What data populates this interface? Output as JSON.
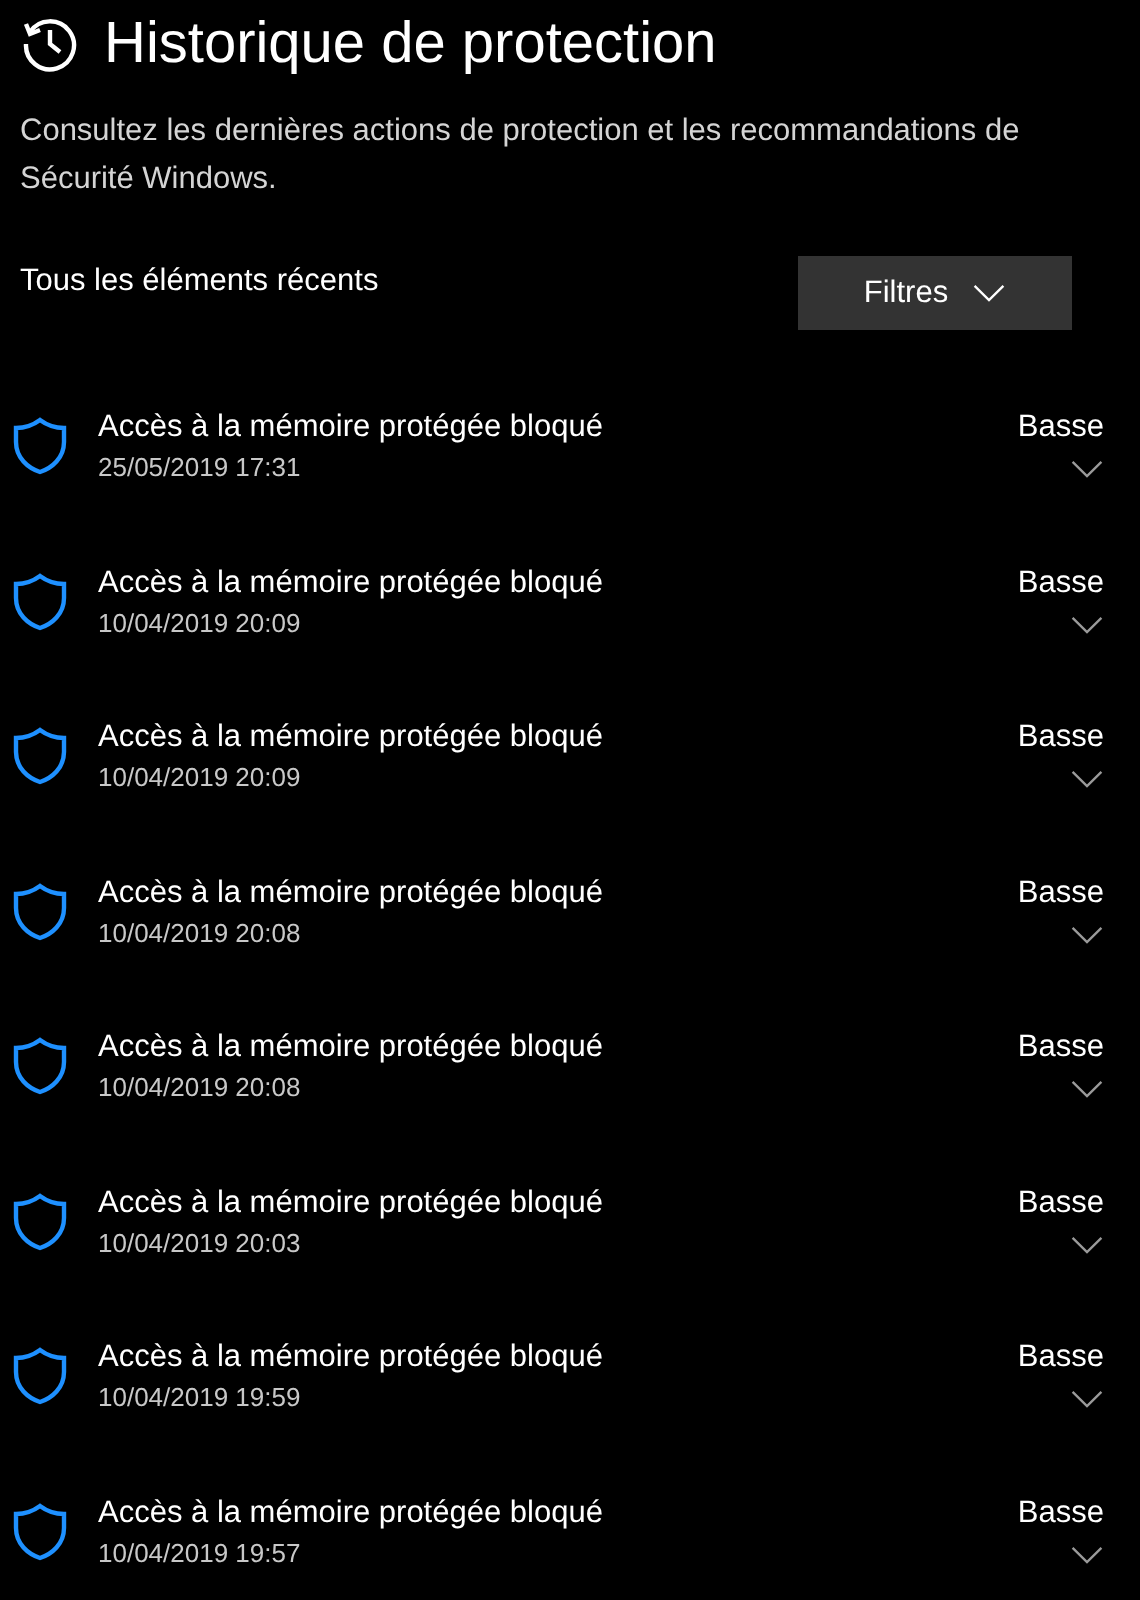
{
  "title": "Historique de protection",
  "description": "Consultez les dernières actions de protection et les recommandations de Sécurité Windows.",
  "list_heading": "Tous les éléments récents",
  "filter_button": {
    "label": "Filtres"
  },
  "items": [
    {
      "title": "Accès à la mémoire protégée bloqué",
      "date": "25/05/2019 17:31",
      "severity": "Basse"
    },
    {
      "title": "Accès à la mémoire protégée bloqué",
      "date": "10/04/2019 20:09",
      "severity": "Basse"
    },
    {
      "title": "Accès à la mémoire protégée bloqué",
      "date": "10/04/2019 20:09",
      "severity": "Basse"
    },
    {
      "title": "Accès à la mémoire protégée bloqué",
      "date": "10/04/2019 20:08",
      "severity": "Basse"
    },
    {
      "title": "Accès à la mémoire protégée bloqué",
      "date": "10/04/2019 20:08",
      "severity": "Basse"
    },
    {
      "title": "Accès à la mémoire protégée bloqué",
      "date": "10/04/2019 20:03",
      "severity": "Basse"
    },
    {
      "title": "Accès à la mémoire protégée bloqué",
      "date": "10/04/2019 19:59",
      "severity": "Basse"
    },
    {
      "title": "Accès à la mémoire protégée bloqué",
      "date": "10/04/2019 19:57",
      "severity": "Basse"
    }
  ]
}
